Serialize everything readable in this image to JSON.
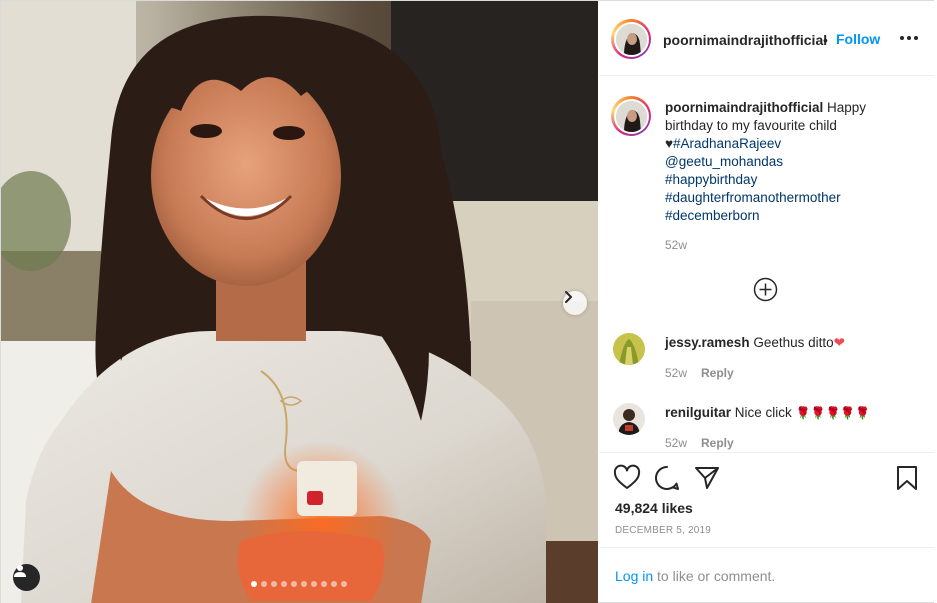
{
  "post": {
    "author": "poornimaindrajithofficial",
    "separator": "•",
    "follow_label": "Follow",
    "more_icon": "more-options-icon"
  },
  "photo": {
    "description_icon": "photo",
    "next_icon": "chevron-right-icon",
    "tag_icon": "user-tag-icon",
    "carousel": {
      "count": 10,
      "active": 1
    }
  },
  "caption": {
    "username": "poornimaindrajithofficial",
    "text": "Happy birthday to my favourite child",
    "heart": "♥",
    "hashtags": [
      "#AradhanaRajeev",
      "@geetu_mohandas",
      "#happybirthday",
      "#daughterfromanothermother",
      "#decemberborn"
    ],
    "time": "52w"
  },
  "load_more_icon": "add-circle-icon",
  "comments": [
    {
      "username": "jessy.ramesh",
      "text": "Geethus ditto",
      "emoji": "❤",
      "time": "52w",
      "reply_label": "Reply"
    },
    {
      "username": "renilguitar",
      "text": "Nice click",
      "emoji": "🌹🌹🌹🌹🌹",
      "time": "52w",
      "reply_label": "Reply"
    }
  ],
  "actions": {
    "like_icon": "heart-icon",
    "comment_icon": "comment-icon",
    "share_icon": "share-icon",
    "save_icon": "bookmark-icon",
    "likes_text": "49,824 likes",
    "date": "DECEMBER 5, 2019"
  },
  "login": {
    "link_label": "Log in",
    "rest_text": " to like or comment."
  },
  "colors": {
    "link_blue": "#0095f6",
    "hashtag_blue": "#00376b",
    "muted": "#8e8e8e",
    "heart_red": "#ed4956"
  }
}
